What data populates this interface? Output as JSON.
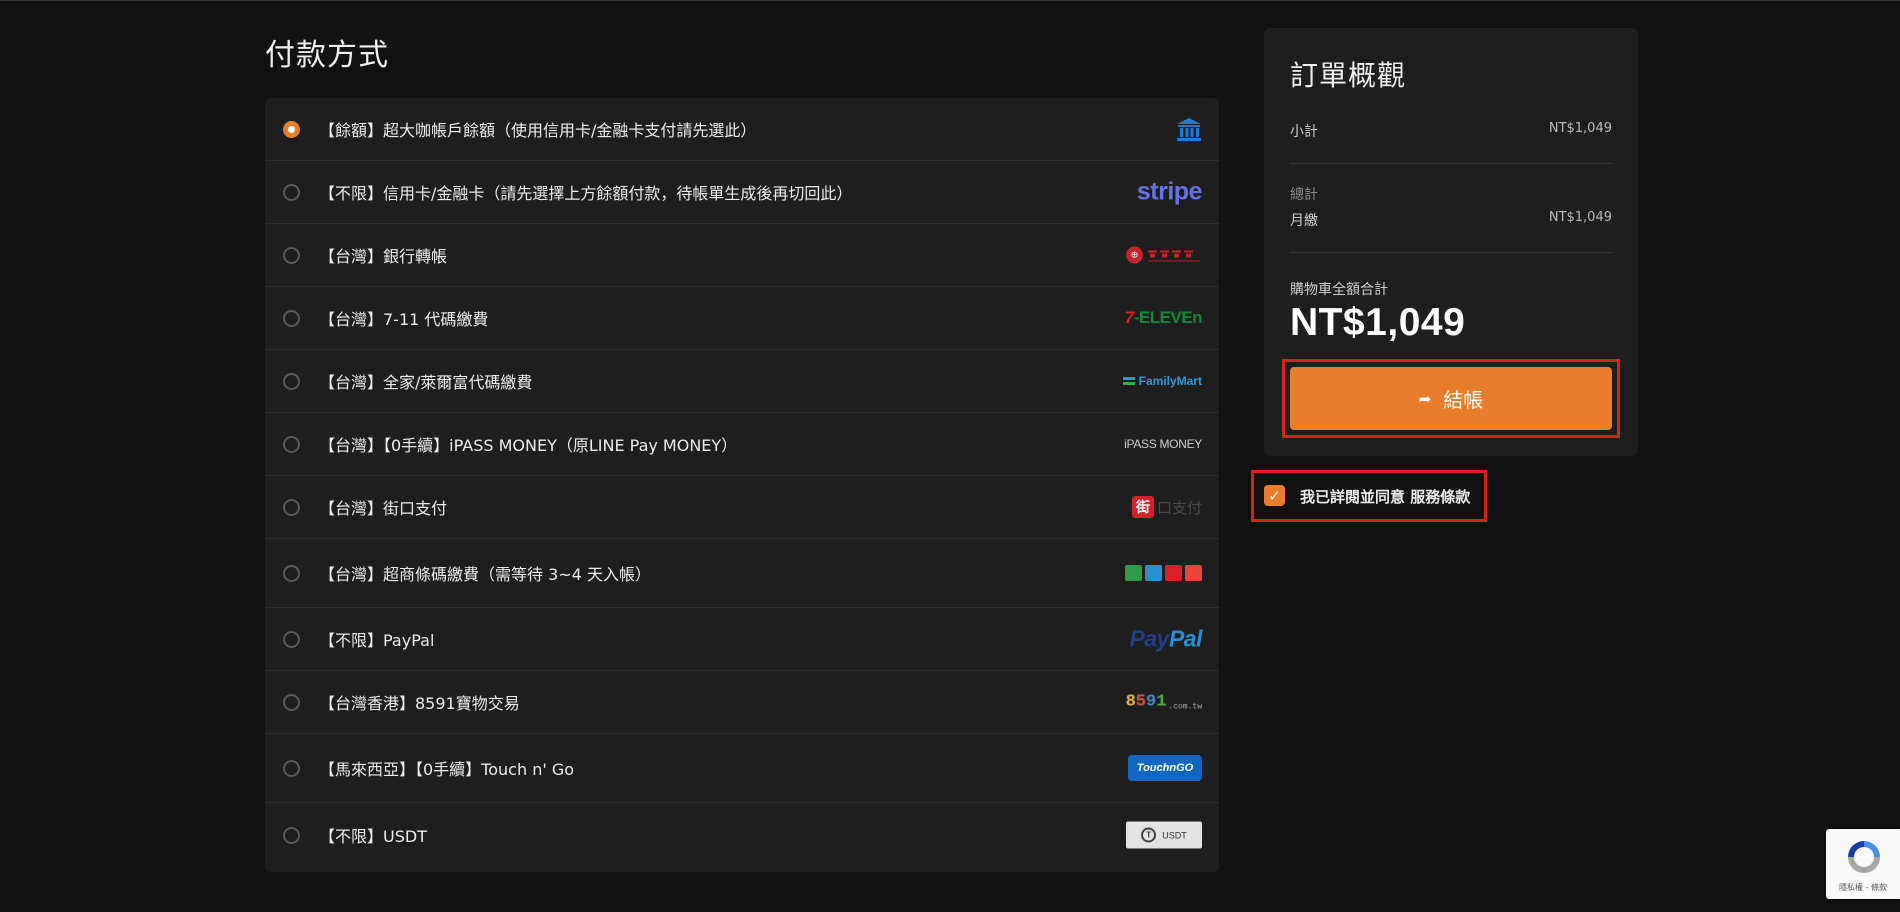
{
  "page_title": "付款方式",
  "payment_methods": [
    {
      "label": "【餘額】超大咖帳戶餘額（使用信用卡/金融卡支付請先選此）",
      "selected": true,
      "logo": "bank-icon"
    },
    {
      "label": "【不限】信用卡/金融卡（請先選擇上方餘額付款，待帳單生成後再切回此）",
      "selected": false,
      "logo": "stripe",
      "logo_text": "stripe"
    },
    {
      "label": "【台灣】銀行轉帳",
      "selected": false,
      "logo": "bank-of-taiwan-logo"
    },
    {
      "label": "【台灣】7-11 代碼繳費",
      "selected": false,
      "logo": "7-eleven-logo",
      "logo_text_a": "7",
      "logo_text_b": "-ELEVEn"
    },
    {
      "label": "【台灣】全家/萊爾富代碼繳費",
      "selected": false,
      "logo": "familymart-logo",
      "logo_text": "FamilyMart"
    },
    {
      "label": "【台灣】【0手續】iPASS MONEY（原LINE Pay MONEY）",
      "selected": false,
      "logo": "ipass-money-logo",
      "logo_text": "iPASS MONEY"
    },
    {
      "label": "【台灣】街口支付",
      "selected": false,
      "logo": "jkopay-logo",
      "logo_text_a": "街",
      "logo_text_b": "口支付"
    },
    {
      "label": "【台灣】超商條碼繳費（需等待 3~4 天入帳）",
      "selected": false,
      "logo": "convenience-stores-logo"
    },
    {
      "label": "【不限】PayPal",
      "selected": false,
      "logo": "paypal-logo",
      "logo_text_a": "Pay",
      "logo_text_b": "Pal"
    },
    {
      "label": "【台灣香港】8591寶物交易",
      "selected": false,
      "logo": "8591-logo",
      "logo_small": ".com.tw"
    },
    {
      "label": "【馬來西亞】【0手續】Touch n' Go",
      "selected": false,
      "logo": "touch-n-go-logo",
      "logo_text": "TouchnGO"
    },
    {
      "label": "【不限】USDT",
      "selected": false,
      "logo": "usdt-logo",
      "logo_text": "USDT"
    }
  ],
  "summary": {
    "title": "訂單概觀",
    "subtotal_label": "小計",
    "subtotal_value": "NT$1,049",
    "total_section_label": "總計",
    "monthly_label": "月繳",
    "monthly_value": "NT$1,049",
    "cart_total_label": "購物車全額合計",
    "cart_total_value": "NT$1,049",
    "checkout_label": "結帳"
  },
  "terms": {
    "checked": true,
    "text": "我已詳閱並同意",
    "link": "服務條款"
  },
  "recaptcha": {
    "text": "隱私權 - 條款"
  },
  "colors": {
    "accent": "#e87d2b",
    "highlight_frame": "#d9211d",
    "panel": "#1e1e1e",
    "background": "#111111"
  }
}
